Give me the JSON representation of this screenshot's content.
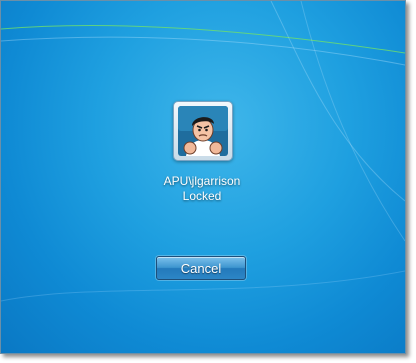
{
  "user": {
    "name": "APU\\jlgarrison",
    "status": "Locked",
    "avatar_icon": "cartoon-man-avatar"
  },
  "actions": {
    "cancel_label": "Cancel"
  },
  "colors": {
    "background_accent": "#1fa0e0",
    "button_accent": "#2c86c6",
    "text": "#ffffff"
  }
}
